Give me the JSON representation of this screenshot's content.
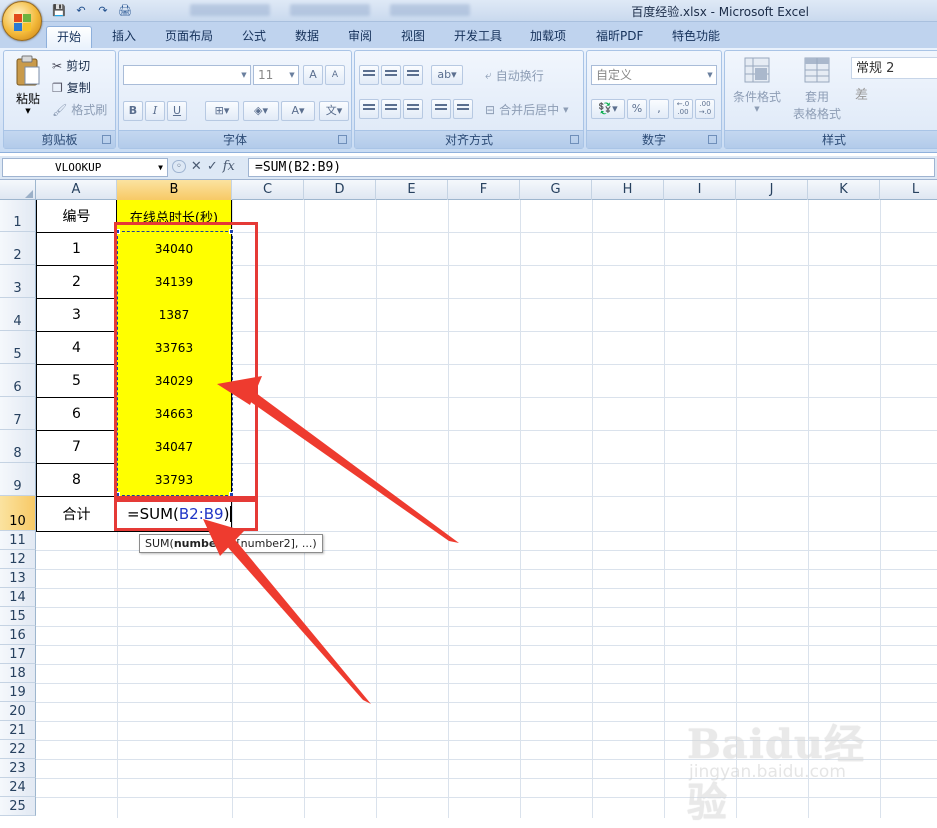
{
  "window": {
    "title": "百度经验.xlsx - Microsoft Excel"
  },
  "qat": {
    "save": "💾",
    "undo": "↶",
    "redo": "↷",
    "print": "🖨"
  },
  "ribbon": {
    "tabs": [
      "开始",
      "插入",
      "页面布局",
      "公式",
      "数据",
      "审阅",
      "视图",
      "开发工具",
      "加载项",
      "福昕PDF",
      "特色功能"
    ],
    "active_tab": "开始",
    "clipboard": {
      "paste": "粘贴",
      "cut": "剪切",
      "copy": "复制",
      "format_painter": "格式刷",
      "label": "剪贴板"
    },
    "font": {
      "name_value": "",
      "size_value": "11",
      "grow": "A",
      "shrink": "A",
      "bold": "B",
      "italic": "I",
      "underline": "U",
      "label": "字体"
    },
    "alignment": {
      "wrap": "自动换行",
      "merge": "合并后居中",
      "label": "对齐方式"
    },
    "number": {
      "format_value": "自定义",
      "percent": "%",
      "comma": ",",
      "inc_dec": "+.0\n.00",
      "dec_dec": ".00\n+.0",
      "label": "数字"
    },
    "styles": {
      "conditional": "条件格式",
      "table_top": "套用",
      "table_bottom": "表格格式",
      "style1": "常规 2",
      "style2": "差",
      "label": "样式"
    }
  },
  "formula_bar": {
    "name_box": "VLOOKUP",
    "cancel": "✕",
    "enter": "✓",
    "fx": "fx",
    "formula": "=SUM(B2:B9)"
  },
  "columns": [
    "A",
    "B",
    "C",
    "D",
    "E",
    "F",
    "G",
    "H",
    "I",
    "J",
    "K",
    "L"
  ],
  "rows": [
    "1",
    "2",
    "3",
    "4",
    "5",
    "6",
    "7",
    "8",
    "9",
    "10",
    "11",
    "12",
    "13",
    "14",
    "15",
    "16",
    "17",
    "18",
    "19",
    "20",
    "21",
    "22",
    "23",
    "24",
    "25"
  ],
  "sheet": {
    "header_a": "编号",
    "header_b": "在线总时长(秒)",
    "ids": [
      "1",
      "2",
      "3",
      "4",
      "5",
      "6",
      "7",
      "8"
    ],
    "values": [
      "34040",
      "34139",
      "1387",
      "33763",
      "34029",
      "34663",
      "34047",
      "33793"
    ],
    "total_label": "合计",
    "formula_prefix": "=SUM(",
    "formula_ref": "B2:B9",
    "formula_suffix": ")"
  },
  "tooltip": {
    "func": "SUM(",
    "arg_bold": "number1",
    "rest": ", [number2], ...)"
  },
  "watermark": {
    "text": "Baidu经验",
    "sub": "jingyan.baidu.com"
  },
  "colors": {
    "highlight": "#ffff00",
    "annotation": "#e53a36",
    "ref": "#2035c6"
  }
}
